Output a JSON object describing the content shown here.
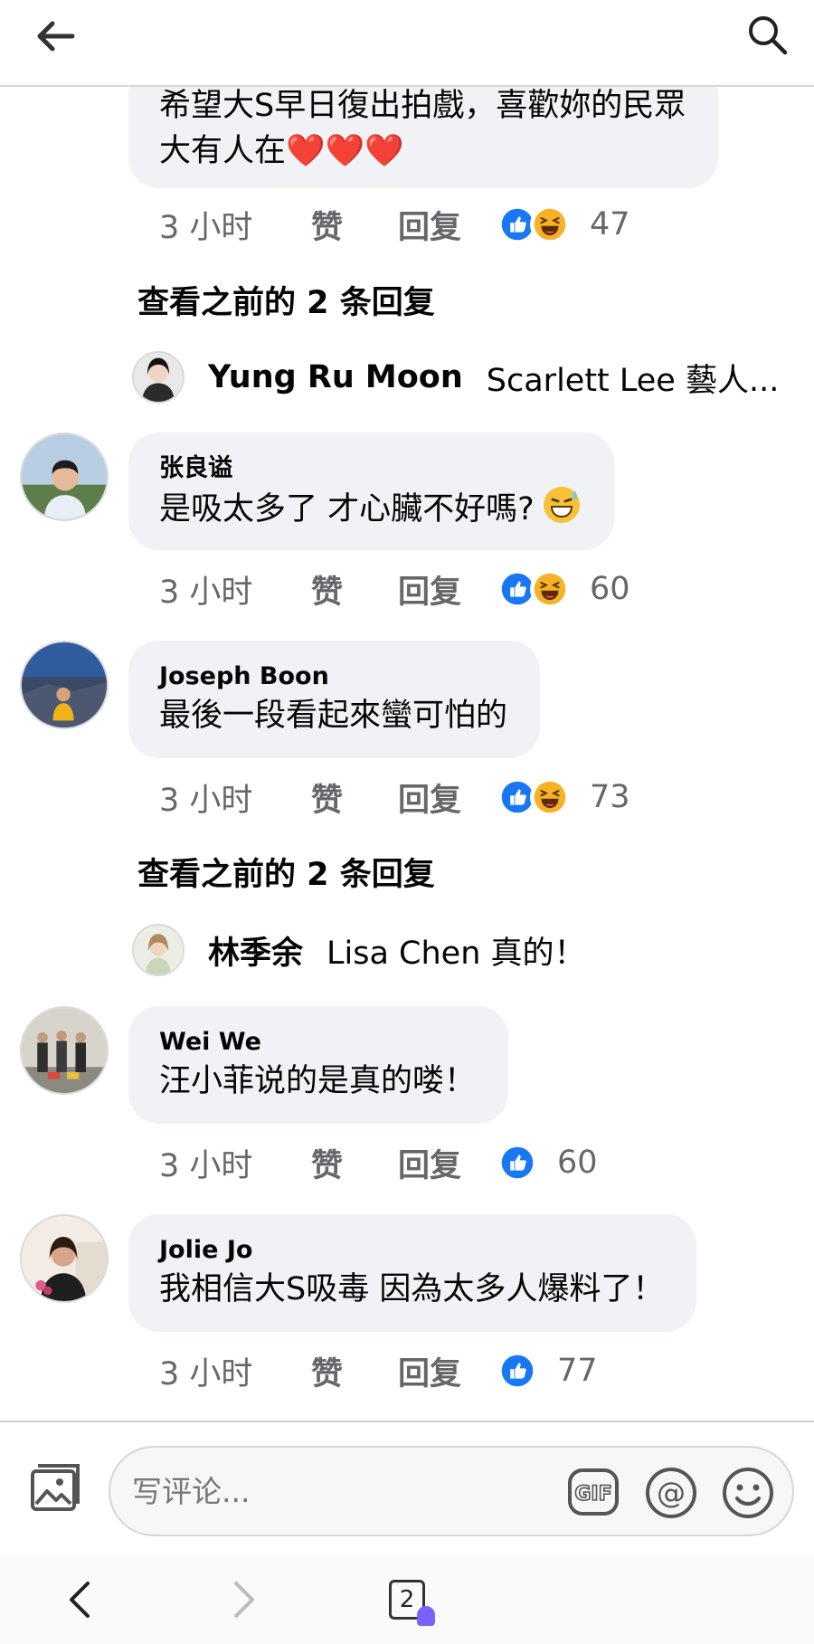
{
  "top_comment": {
    "text_line1": "希望大S早日復出拍戲，喜歡妳的民眾",
    "text_line2": "大有人在",
    "emojis": "❤️❤️❤️",
    "time": "3 小时",
    "like_label": "赞",
    "reply_label": "回复",
    "reactions": [
      "like",
      "haha"
    ],
    "count": "47"
  },
  "prev_replies_1": "查看之前的 2 条回复",
  "reply_1": {
    "name": "Yung Ru Moon",
    "text": "Scarlett Lee 藝人..."
  },
  "comments": [
    {
      "author": "张良谥",
      "text": "是吸太多了 才心臟不好嗎?",
      "emoji": "😅",
      "time": "3 小时",
      "like_label": "赞",
      "reply_label": "回复",
      "reactions": [
        "like",
        "haha"
      ],
      "count": "60"
    },
    {
      "author": "Joseph Boon",
      "text": "最後一段看起來蠻可怕的",
      "time": "3 小时",
      "like_label": "赞",
      "reply_label": "回复",
      "reactions": [
        "like",
        "haha"
      ],
      "count": "73"
    },
    {
      "author": "Wei We",
      "text": "汪小菲说的是真的喽！",
      "time": "3 小时",
      "like_label": "赞",
      "reply_label": "回复",
      "reactions": [
        "like"
      ],
      "count": "60"
    },
    {
      "author": "Jolie Jo",
      "text": "我相信大S吸毒 因為太多人爆料了！",
      "time": "3 小时",
      "like_label": "赞",
      "reply_label": "回复",
      "reactions": [
        "like"
      ],
      "count": "77"
    }
  ],
  "prev_replies_2": "查看之前的 2 条回复",
  "reply_2": {
    "name": "林季余",
    "text": "Lisa Chen 真的！"
  },
  "composer": {
    "placeholder": "写评论..."
  },
  "navbar": {
    "tab_count": "2"
  },
  "colors": {
    "like_blue": "#1877f2",
    "haha_yellow": "#f7b125",
    "bubble_bg": "#f0f2f5",
    "meta_gray": "#65676b"
  },
  "icons": [
    "back-arrow-icon",
    "search-icon",
    "like-reaction-icon",
    "haha-reaction-icon",
    "photo-icon",
    "gif-icon",
    "at-icon",
    "smile-icon",
    "chevron-left-icon",
    "chevron-right-icon",
    "tabs-icon"
  ]
}
